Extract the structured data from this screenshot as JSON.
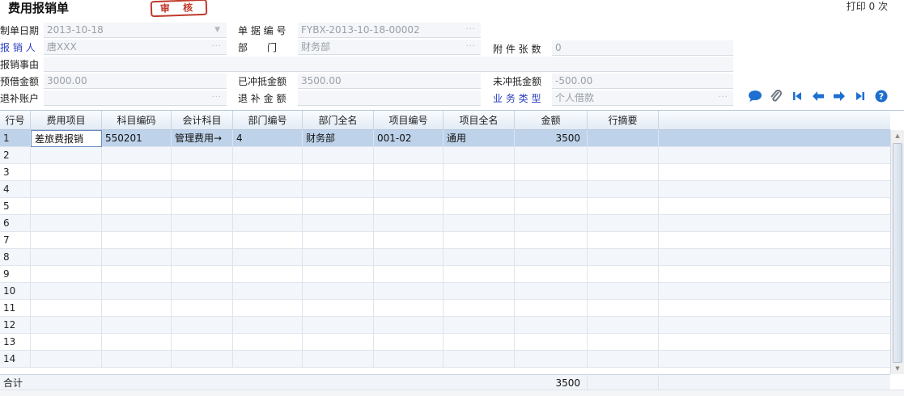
{
  "header": {
    "title": "费用报销单",
    "stamp": "审 核",
    "print_count": "打印 0 次"
  },
  "form": {
    "date_label": "制单日期",
    "date_value": "2013-10-18",
    "doc_no_label": "单 据 编 号",
    "doc_no_value": "FYBX-2013-10-18-00002",
    "reporter_label": "报 销 人",
    "reporter_value": "唐XXX",
    "dept_label": "部　　门",
    "dept_value": "财务部",
    "attach_label": "附 件 张 数",
    "attach_value": "0",
    "reason_label": "报销事由",
    "reason_value": "",
    "loan_label": "预借金额",
    "loan_value": "3000.00",
    "offset_label": "已冲抵金额",
    "offset_value": "3500.00",
    "unoffset_label": "未冲抵金额",
    "unoffset_value": "-500.00",
    "refund_acct_label": "退补账户",
    "refund_acct_value": "",
    "refund_amt_label": "退 补 金 额",
    "refund_amt_value": "",
    "biz_type_label": "业 务 类 型",
    "biz_type_value": "个人借款",
    "lookup_dots": "···",
    "dropdown_arrow": "▼"
  },
  "toolbar": {
    "icons": [
      "comment-icon",
      "attachment-icon",
      "first-record-icon",
      "prev-record-icon",
      "next-record-icon",
      "last-record-icon",
      "help-icon"
    ],
    "accent": "#1e6fd0"
  },
  "grid": {
    "columns": [
      "行号",
      "费用项目",
      "科目编码",
      "会计科目",
      "部门编号",
      "部门全名",
      "项目编号",
      "项目全名",
      "金额",
      "行摘要"
    ],
    "rows": [
      [
        "1",
        "差旅费报销",
        "550201",
        "管理费用→",
        "4",
        "财务部",
        "001-02",
        "通用",
        "3500",
        ""
      ],
      [
        "2",
        "",
        "",
        "",
        "",
        "",
        "",
        "",
        "",
        ""
      ],
      [
        "3",
        "",
        "",
        "",
        "",
        "",
        "",
        "",
        "",
        ""
      ],
      [
        "4",
        "",
        "",
        "",
        "",
        "",
        "",
        "",
        "",
        ""
      ],
      [
        "5",
        "",
        "",
        "",
        "",
        "",
        "",
        "",
        "",
        ""
      ],
      [
        "6",
        "",
        "",
        "",
        "",
        "",
        "",
        "",
        "",
        ""
      ],
      [
        "7",
        "",
        "",
        "",
        "",
        "",
        "",
        "",
        "",
        ""
      ],
      [
        "8",
        "",
        "",
        "",
        "",
        "",
        "",
        "",
        "",
        ""
      ],
      [
        "9",
        "",
        "",
        "",
        "",
        "",
        "",
        "",
        "",
        ""
      ],
      [
        "10",
        "",
        "",
        "",
        "",
        "",
        "",
        "",
        "",
        ""
      ],
      [
        "11",
        "",
        "",
        "",
        "",
        "",
        "",
        "",
        "",
        ""
      ],
      [
        "12",
        "",
        "",
        "",
        "",
        "",
        "",
        "",
        "",
        ""
      ],
      [
        "13",
        "",
        "",
        "",
        "",
        "",
        "",
        "",
        "",
        ""
      ],
      [
        "14",
        "",
        "",
        "",
        "",
        "",
        "",
        "",
        "",
        ""
      ]
    ],
    "footer_label": "合计",
    "footer_total": "3500"
  }
}
